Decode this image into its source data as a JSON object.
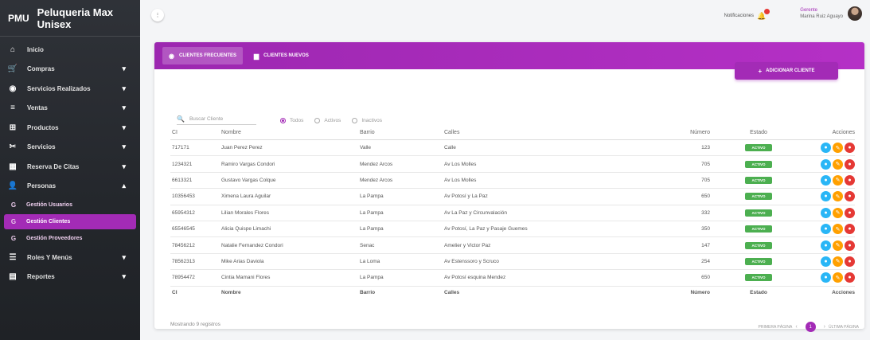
{
  "brand": {
    "abbr": "PMU",
    "name": "Peluqueria Max Unisex"
  },
  "sidebar": {
    "items": [
      {
        "label": "Inicio",
        "icon": "home-icon",
        "glyph": "⌂",
        "caret": ""
      },
      {
        "label": "Compras",
        "icon": "cart-icon",
        "glyph": "🛒",
        "caret": "▾"
      },
      {
        "label": "Servicios Realizados",
        "icon": "services-icon",
        "glyph": "◉",
        "caret": "▾"
      },
      {
        "label": "Ventas",
        "icon": "sales-icon",
        "glyph": "≡",
        "caret": "▾"
      },
      {
        "label": "Productos",
        "icon": "products-icon",
        "glyph": "⊞",
        "caret": "▾"
      },
      {
        "label": "Servicios",
        "icon": "scissors-icon",
        "glyph": "✂",
        "caret": "▾"
      },
      {
        "label": "Reserva De Citas",
        "icon": "calendar-icon",
        "glyph": "▦",
        "caret": "▾"
      },
      {
        "label": "Personas",
        "icon": "person-icon",
        "glyph": "👤",
        "caret": "▴"
      }
    ],
    "subitems": [
      {
        "label": "Gestión Usuarios",
        "letter": "G"
      },
      {
        "label": "Gestión Clientes",
        "letter": "G",
        "active": true
      },
      {
        "label": "Gestión Proveedores",
        "letter": "G"
      }
    ],
    "items2": [
      {
        "label": "Roles Y Menús",
        "icon": "list-icon",
        "glyph": "☰",
        "caret": "▾"
      },
      {
        "label": "Reportes",
        "icon": "report-icon",
        "glyph": "▤",
        "caret": "▾"
      }
    ]
  },
  "topbar": {
    "menu_glyph": "⋮",
    "notifications_label": "Notificaciones",
    "user_role": "Gerente",
    "user_name": "Marina Ruiz Aguayo"
  },
  "tabs": [
    {
      "label": "CLIENTES FRECUENTES",
      "icon": "clients-icon",
      "glyph": "◉",
      "active": true
    },
    {
      "label": "CLIENTES NUEVOS",
      "icon": "new-clients-icon",
      "glyph": "▆"
    }
  ],
  "add_button": {
    "plus": "+",
    "label": "ADICIONAR CLIENTE"
  },
  "filters": {
    "search_placeholder": "Buscar Cliente",
    "options": [
      "Todos",
      "Activos",
      "Inactivos"
    ],
    "selected": "Todos"
  },
  "table": {
    "headers": [
      "CI",
      "Nombre",
      "Barrio",
      "Calles",
      "Número",
      "Estado",
      "Acciones"
    ],
    "rows": [
      {
        "ci": "717171",
        "nombre": "Juan Perez Perez",
        "barrio": "Valle",
        "calles": "Calle",
        "numero": "123",
        "estado": "ACTIVO"
      },
      {
        "ci": "1234321",
        "nombre": "Ramiro Vargas Condori",
        "barrio": "Mendez Arcos",
        "calles": "Av Los Molles",
        "numero": "705",
        "estado": "ACTIVO"
      },
      {
        "ci": "6613321",
        "nombre": "Gustavo Vargas Colque",
        "barrio": "Mendez Arcos",
        "calles": "Av Los Molles",
        "numero": "705",
        "estado": "ACTIVO"
      },
      {
        "ci": "10356453",
        "nombre": "Ximena Laura Aguilar",
        "barrio": "La Pampa",
        "calles": "Av Potosí y La Paz",
        "numero": "650",
        "estado": "ACTIVO"
      },
      {
        "ci": "65954312",
        "nombre": "Lilian Morales Flores",
        "barrio": "La Pampa",
        "calles": "Av La Paz y Circunvalación",
        "numero": "332",
        "estado": "ACTIVO"
      },
      {
        "ci": "65546545",
        "nombre": "Alicia Quispe Limachi",
        "barrio": "La Pampa",
        "calles": "Av Potosí, La Paz y Pasaje Guemes",
        "numero": "350",
        "estado": "ACTIVO"
      },
      {
        "ci": "78456212",
        "nombre": "Natalie Fernandez Condori",
        "barrio": "Senac",
        "calles": "Amelier y Victor Paz",
        "numero": "147",
        "estado": "ACTIVO"
      },
      {
        "ci": "78562313",
        "nombre": "Mike Arias Daviola",
        "barrio": "La Loma",
        "calles": "Av Estenssoro y Scruco",
        "numero": "254",
        "estado": "ACTIVO"
      },
      {
        "ci": "78954472",
        "nombre": "Cintia Mamani Flores",
        "barrio": "La Pampa",
        "calles": "Av Potosí esquina Mendez",
        "numero": "650",
        "estado": "ACTIVO"
      }
    ]
  },
  "footer": {
    "showing": "Mostrando 9 registros",
    "first_page": "PRIMERA PÁGINA",
    "prev": "‹",
    "page": "1",
    "next": "›",
    "last_page": "ÚLTIMA PÁGINA"
  },
  "colors": {
    "accent": "#a32bb6",
    "active_badge": "#4caf50",
    "view": "#29b6f6",
    "edit": "#ffa000",
    "delete": "#e53935"
  }
}
